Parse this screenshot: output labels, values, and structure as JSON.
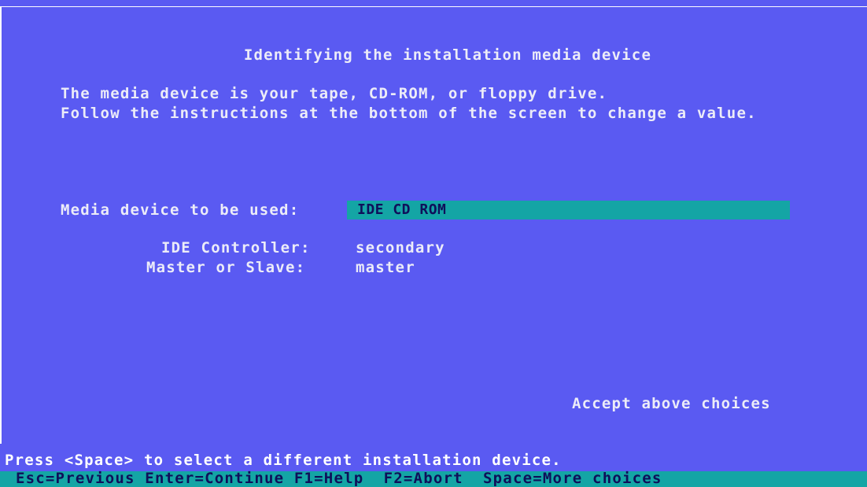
{
  "dialog": {
    "title": "Identifying the installation media device",
    "intro_line1": "The media device is your tape, CD-ROM, or floppy drive.",
    "intro_line2": "Follow the instructions at the bottom of the screen to change a value."
  },
  "fields": {
    "media_device_label": "Media device to be used:",
    "media_device_value": "IDE CD ROM",
    "ide_controller_label": "IDE Controller:",
    "ide_controller_value": "secondary",
    "master_slave_label": "Master or Slave:",
    "master_slave_value": "master"
  },
  "accept_label": "Accept above choices",
  "footer": {
    "hint": "Press <Space> to select a different installation device.",
    "keys": "Esc=Previous Enter=Continue F1=Help  F2=Abort  Space=More choices"
  },
  "colors": {
    "background": "#5a5af2",
    "highlight": "#14a5a5",
    "text": "#ececf8",
    "highlight_text": "#0f0f5a"
  }
}
